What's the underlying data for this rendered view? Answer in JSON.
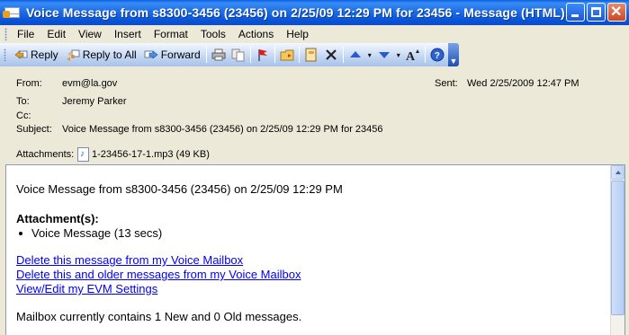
{
  "window": {
    "title": "Voice Message from s8300-3456 (23456) on 2/25/09 12:29 PM for 23456 - Message (HTML)"
  },
  "menu": [
    "File",
    "Edit",
    "View",
    "Insert",
    "Format",
    "Tools",
    "Actions",
    "Help"
  ],
  "toolbar": {
    "reply": "Reply",
    "reply_all": "Reply to All",
    "forward": "Forward"
  },
  "header": {
    "from_label": "From:",
    "from_value": "evm@la.gov",
    "to_label": "To:",
    "to_value": "Jeremy Parker",
    "cc_label": "Cc:",
    "cc_value": "",
    "subject_label": "Subject:",
    "subject_value": "Voice Message from s8300-3456 (23456) on 2/25/09 12:29 PM for 23456",
    "sent_label": "Sent:",
    "sent_value": "Wed 2/25/2009 12:47 PM",
    "attachments_label": "Attachments:",
    "attachment_file": "1-23456-17-1.mp3 (49 KB)"
  },
  "body": {
    "heading": "Voice Message from s8300-3456 (23456) on 2/25/09 12:29 PM",
    "attachments_title": "Attachment(s):",
    "attachment_item": "Voice Message (13 secs)",
    "links": [
      "Delete this message from my Voice Mailbox",
      "Delete this and older messages from my Voice Mailbox",
      "View/Edit my EVM Settings"
    ],
    "mailbox_status": "Mailbox currently contains 1 New and 0 Old messages."
  }
}
